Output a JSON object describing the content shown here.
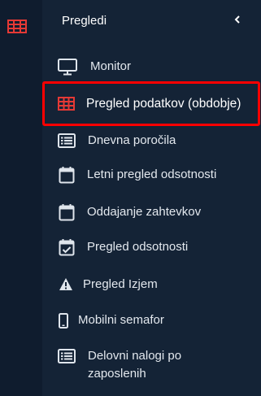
{
  "sidebar": {
    "title": "Pregledi",
    "items": [
      {
        "label": "Monitor",
        "icon": "monitor-icon"
      },
      {
        "label": "Pregled podatkov (obdobje)",
        "icon": "table-grid-icon",
        "active": true
      },
      {
        "label": "Dnevna poročila",
        "icon": "list-card-icon"
      },
      {
        "label": "Letni pregled odsotnosti",
        "icon": "calendar-icon"
      },
      {
        "label": "Oddajanje zahtevkov",
        "icon": "calendar-icon"
      },
      {
        "label": "Pregled odsotnosti",
        "icon": "calendar-check-icon"
      },
      {
        "label": "Pregled Izjem",
        "icon": "warning-icon"
      },
      {
        "label": "Mobilni semafor",
        "icon": "mobile-phone-icon"
      },
      {
        "label": "Delovni nalogi po zaposlenih",
        "icon": "list-card-icon"
      }
    ]
  },
  "colors": {
    "background": "#0f1c2e",
    "panel": "#142336",
    "accent": "#e53935",
    "highlight_border": "#ff0000",
    "text": "#e3e8ee"
  }
}
